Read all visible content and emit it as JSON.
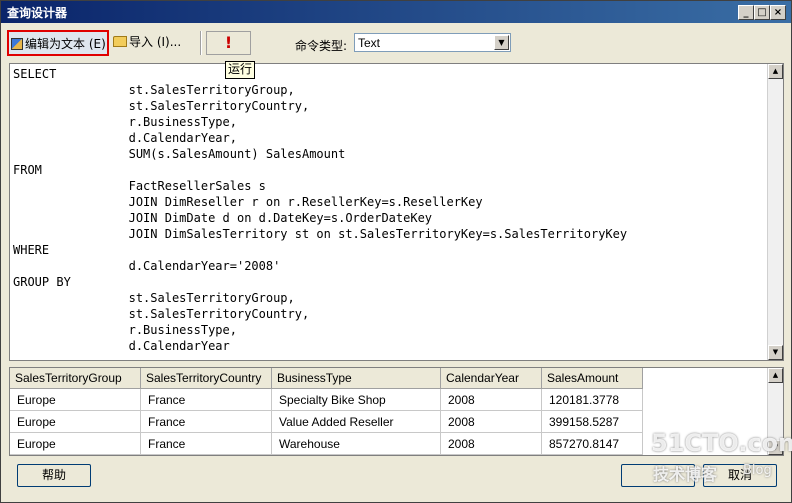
{
  "window": {
    "title": "查询设计器"
  },
  "toolbar": {
    "edit_as_text_label": "编辑为文本 (E)",
    "import_label": "导入 (I)...",
    "run_icon": "exclamation-icon",
    "run_tooltip": "运行",
    "command_type_label": "命令类型:",
    "command_type_value": "Text"
  },
  "sql": {
    "lines": [
      "SELECT",
      "                st.SalesTerritoryGroup,",
      "                st.SalesTerritoryCountry,",
      "                r.BusinessType,",
      "                d.CalendarYear,",
      "                SUM(s.SalesAmount) SalesAmount",
      "FROM",
      "                FactResellerSales s",
      "                JOIN DimReseller r on r.ResellerKey=s.ResellerKey",
      "                JOIN DimDate d on d.DateKey=s.OrderDateKey",
      "                JOIN DimSalesTerritory st on st.SalesTerritoryKey=s.SalesTerritoryKey",
      "WHERE",
      "                d.CalendarYear='2008'",
      "GROUP BY",
      "                st.SalesTerritoryGroup,",
      "                st.SalesTerritoryCountry,",
      "                r.BusinessType,",
      "                d.CalendarYear"
    ]
  },
  "results": {
    "columns": [
      "SalesTerritoryGroup",
      "SalesTerritoryCountry",
      "BusinessType",
      "CalendarYear",
      "SalesAmount"
    ],
    "rows": [
      [
        "Europe",
        "France",
        "Specialty Bike Shop",
        "2008",
        "120181.3778"
      ],
      [
        "Europe",
        "France",
        "Value Added Reseller",
        "2008",
        "399158.5287"
      ],
      [
        "Europe",
        "France",
        "Warehouse",
        "2008",
        "857270.8147"
      ]
    ]
  },
  "footer": {
    "help_label": "帮助",
    "cancel_label": "取消"
  },
  "watermark": {
    "line1": "51CTO.com",
    "line2": "技术博客",
    "line3": "Blog"
  },
  "colors": {
    "titlebar": "#0a246a",
    "highlight_border": "#e00000",
    "run_icon": "#cc0000"
  }
}
